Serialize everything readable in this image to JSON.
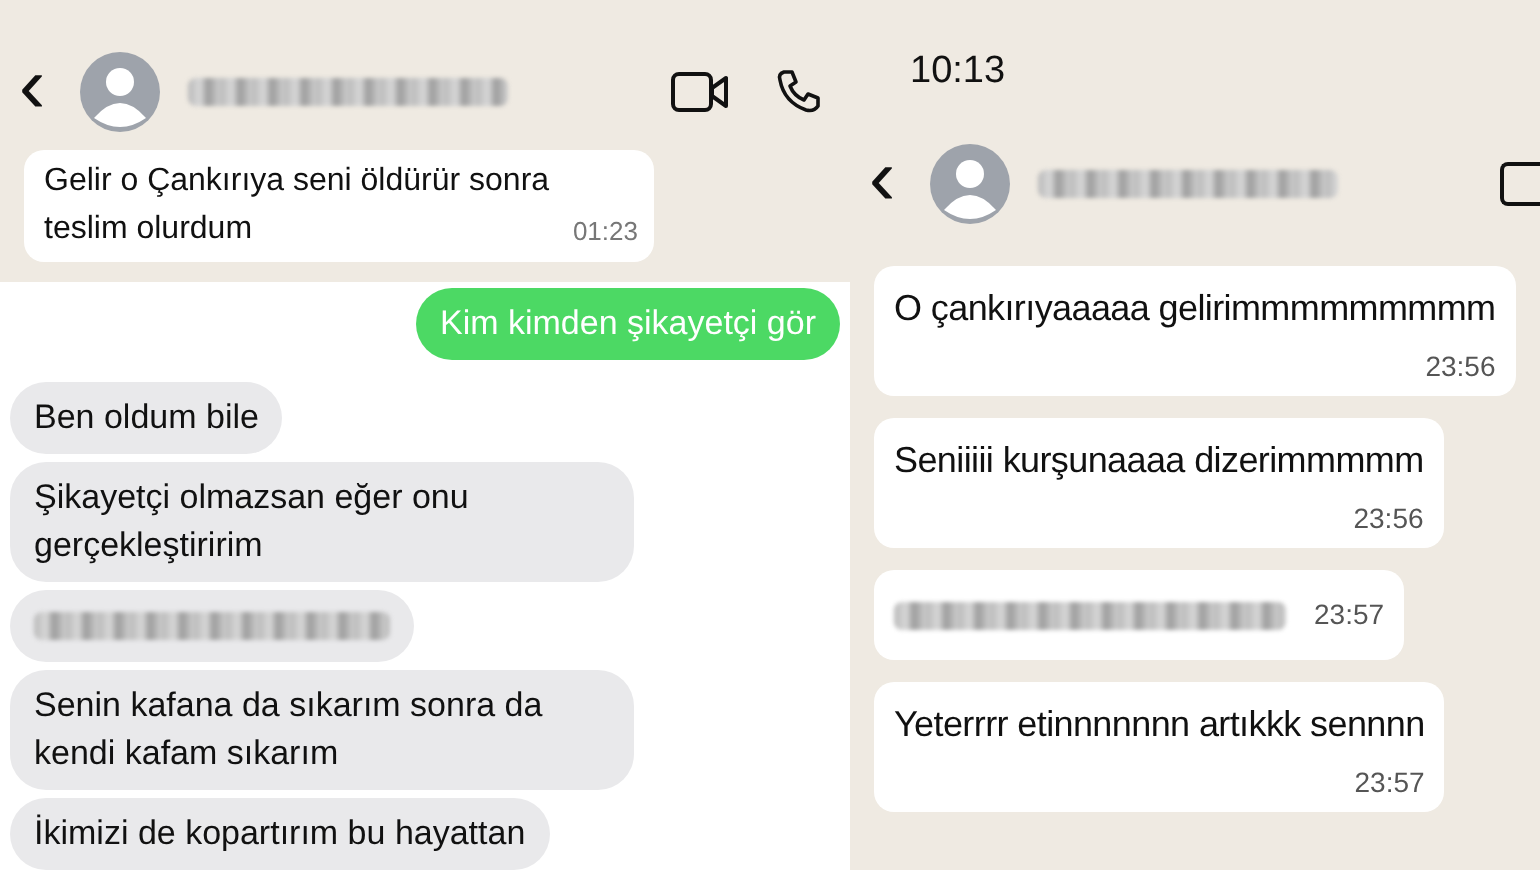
{
  "left_screen": {
    "chat_header": {
      "back": "‹"
    },
    "whatsapp_messages": [
      {
        "text": "Gelir o Çankırıya seni öldürür sonra teslim olurdum",
        "time": "01:23"
      }
    ],
    "imessage_messages": [
      {
        "kind": "text",
        "outgoing": true,
        "text": "Kim kimden şikayetçi gör"
      },
      {
        "kind": "text",
        "outgoing": false,
        "text": "Ben oldum bile"
      },
      {
        "kind": "text",
        "outgoing": false,
        "text": "Şikayetçi olmazsan eğer onu gerçekleştiririm"
      },
      {
        "kind": "redacted",
        "outgoing": false
      },
      {
        "kind": "text",
        "outgoing": false,
        "text": "Senin kafana da sıkarım sonra da kendi kafam sıkarım"
      },
      {
        "kind": "text",
        "outgoing": false,
        "text": "İkimizi de kopartırım bu hayattan"
      }
    ]
  },
  "right_screen": {
    "status_time": "10:13",
    "chat_header": {
      "back": "‹"
    },
    "messages": [
      {
        "kind": "text",
        "text": "O çankırıyaaaaa gelirimmmmmmmmm",
        "time": "23:56"
      },
      {
        "kind": "text",
        "text": "Seniiiii kurşunaaaa dizerimmmmm",
        "time": "23:56"
      },
      {
        "kind": "redacted",
        "time": "23:57"
      },
      {
        "kind": "text",
        "text": "Yeterrrr etinnnnnnn artıkkk sennnn",
        "time": "23:57"
      }
    ]
  }
}
